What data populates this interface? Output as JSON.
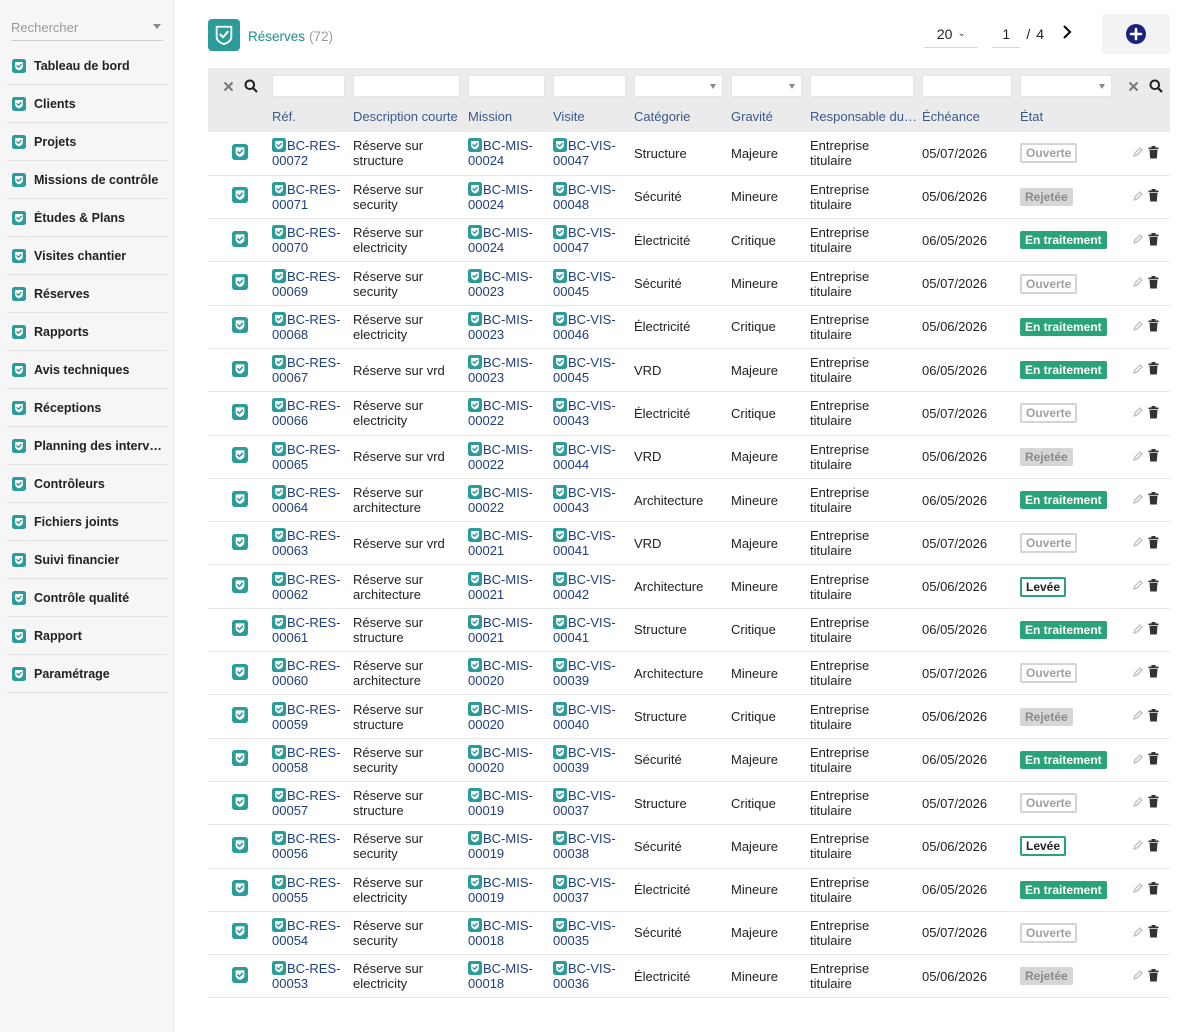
{
  "sidebar": {
    "search_placeholder": "Rechercher",
    "items": [
      {
        "label": "Tableau de bord"
      },
      {
        "label": "Clients"
      },
      {
        "label": "Projets"
      },
      {
        "label": "Missions de contrôle"
      },
      {
        "label": "Études & Plans"
      },
      {
        "label": "Visites chantier"
      },
      {
        "label": "Réserves"
      },
      {
        "label": "Rapports"
      },
      {
        "label": "Avis techniques"
      },
      {
        "label": "Réceptions"
      },
      {
        "label": "Planning des interventions"
      },
      {
        "label": "Contrôleurs"
      },
      {
        "label": "Fichiers joints"
      },
      {
        "label": "Suivi financier"
      },
      {
        "label": "Contrôle qualité"
      },
      {
        "label": "Rapport"
      },
      {
        "label": "Paramétrage"
      }
    ]
  },
  "header": {
    "title": "Réserves",
    "count": "(72)",
    "limit": "20",
    "page": "1",
    "page_sep": "/",
    "total_pages": "4"
  },
  "columns": {
    "ref": "Réf.",
    "desc": "Description courte",
    "mission": "Mission",
    "visite": "Visite",
    "categorie": "Catégorie",
    "gravite": "Gravité",
    "responsable": "Responsable du traitement",
    "echeance": "Échéance",
    "etat": "État"
  },
  "colors": {
    "accent": "#2b9c99",
    "link": "#1f3f7a",
    "status_green": "#2aa27a",
    "add_icon": "#1a237e"
  },
  "icons": {
    "row_checkbox": "shield-check-icon",
    "edit": "pencil-icon",
    "delete": "trash-icon",
    "clear": "close-icon",
    "search": "search-icon",
    "add": "plus-circle-icon",
    "next": "chevron-right-icon"
  },
  "rows": [
    {
      "ref1": "BC-RES-",
      "ref2": "00072",
      "desc1": "Réserve sur",
      "desc2": "structure",
      "mis1": "BC-MIS-",
      "mis2": "00024",
      "vis1": "BC-VIS-",
      "vis2": "00047",
      "cat": "Structure",
      "grav": "Majeure",
      "resp1": "Entreprise",
      "resp2": "titulaire",
      "ech": "05/07/2026",
      "etat": "Ouverte",
      "etat_class": "b-ouverte"
    },
    {
      "ref1": "BC-RES-",
      "ref2": "00071",
      "desc1": "Réserve sur",
      "desc2": "security",
      "mis1": "BC-MIS-",
      "mis2": "00024",
      "vis1": "BC-VIS-",
      "vis2": "00048",
      "cat": "Sécurité",
      "grav": "Mineure",
      "resp1": "Entreprise",
      "resp2": "titulaire",
      "ech": "05/06/2026",
      "etat": "Rejetée",
      "etat_class": "b-rejetee"
    },
    {
      "ref1": "BC-RES-",
      "ref2": "00070",
      "desc1": "Réserve sur",
      "desc2": "electricity",
      "mis1": "BC-MIS-",
      "mis2": "00024",
      "vis1": "BC-VIS-",
      "vis2": "00047",
      "cat": "Électricité",
      "grav": "Critique",
      "resp1": "Entreprise",
      "resp2": "titulaire",
      "ech": "06/05/2026",
      "etat": "En traitement",
      "etat_class": "b-traitement"
    },
    {
      "ref1": "BC-RES-",
      "ref2": "00069",
      "desc1": "Réserve sur",
      "desc2": "security",
      "mis1": "BC-MIS-",
      "mis2": "00023",
      "vis1": "BC-VIS-",
      "vis2": "00045",
      "cat": "Sécurité",
      "grav": "Mineure",
      "resp1": "Entreprise",
      "resp2": "titulaire",
      "ech": "05/07/2026",
      "etat": "Ouverte",
      "etat_class": "b-ouverte"
    },
    {
      "ref1": "BC-RES-",
      "ref2": "00068",
      "desc1": "Réserve sur",
      "desc2": "electricity",
      "mis1": "BC-MIS-",
      "mis2": "00023",
      "vis1": "BC-VIS-",
      "vis2": "00046",
      "cat": "Électricité",
      "grav": "Critique",
      "resp1": "Entreprise",
      "resp2": "titulaire",
      "ech": "05/06/2026",
      "etat": "En traitement",
      "etat_class": "b-traitement"
    },
    {
      "ref1": "BC-RES-",
      "ref2": "00067",
      "desc1": "Réserve sur vrd",
      "desc2": "",
      "mis1": "BC-MIS-",
      "mis2": "00023",
      "vis1": "BC-VIS-",
      "vis2": "00045",
      "cat": "VRD",
      "grav": "Majeure",
      "resp1": "Entreprise",
      "resp2": "titulaire",
      "ech": "06/05/2026",
      "etat": "En traitement",
      "etat_class": "b-traitement"
    },
    {
      "ref1": "BC-RES-",
      "ref2": "00066",
      "desc1": "Réserve sur",
      "desc2": "electricity",
      "mis1": "BC-MIS-",
      "mis2": "00022",
      "vis1": "BC-VIS-",
      "vis2": "00043",
      "cat": "Électricité",
      "grav": "Critique",
      "resp1": "Entreprise",
      "resp2": "titulaire",
      "ech": "05/07/2026",
      "etat": "Ouverte",
      "etat_class": "b-ouverte"
    },
    {
      "ref1": "BC-RES-",
      "ref2": "00065",
      "desc1": "Réserve sur vrd",
      "desc2": "",
      "mis1": "BC-MIS-",
      "mis2": "00022",
      "vis1": "BC-VIS-",
      "vis2": "00044",
      "cat": "VRD",
      "grav": "Majeure",
      "resp1": "Entreprise",
      "resp2": "titulaire",
      "ech": "05/06/2026",
      "etat": "Rejetée",
      "etat_class": "b-rejetee"
    },
    {
      "ref1": "BC-RES-",
      "ref2": "00064",
      "desc1": "Réserve sur",
      "desc2": "architecture",
      "mis1": "BC-MIS-",
      "mis2": "00022",
      "vis1": "BC-VIS-",
      "vis2": "00043",
      "cat": "Architecture",
      "grav": "Mineure",
      "resp1": "Entreprise",
      "resp2": "titulaire",
      "ech": "06/05/2026",
      "etat": "En traitement",
      "etat_class": "b-traitement"
    },
    {
      "ref1": "BC-RES-",
      "ref2": "00063",
      "desc1": "Réserve sur vrd",
      "desc2": "",
      "mis1": "BC-MIS-",
      "mis2": "00021",
      "vis1": "BC-VIS-",
      "vis2": "00041",
      "cat": "VRD",
      "grav": "Majeure",
      "resp1": "Entreprise",
      "resp2": "titulaire",
      "ech": "05/07/2026",
      "etat": "Ouverte",
      "etat_class": "b-ouverte"
    },
    {
      "ref1": "BC-RES-",
      "ref2": "00062",
      "desc1": "Réserve sur",
      "desc2": "architecture",
      "mis1": "BC-MIS-",
      "mis2": "00021",
      "vis1": "BC-VIS-",
      "vis2": "00042",
      "cat": "Architecture",
      "grav": "Mineure",
      "resp1": "Entreprise",
      "resp2": "titulaire",
      "ech": "05/06/2026",
      "etat": "Levée",
      "etat_class": "b-levee"
    },
    {
      "ref1": "BC-RES-",
      "ref2": "00061",
      "desc1": "Réserve sur",
      "desc2": "structure",
      "mis1": "BC-MIS-",
      "mis2": "00021",
      "vis1": "BC-VIS-",
      "vis2": "00041",
      "cat": "Structure",
      "grav": "Critique",
      "resp1": "Entreprise",
      "resp2": "titulaire",
      "ech": "06/05/2026",
      "etat": "En traitement",
      "etat_class": "b-traitement"
    },
    {
      "ref1": "BC-RES-",
      "ref2": "00060",
      "desc1": "Réserve sur",
      "desc2": "architecture",
      "mis1": "BC-MIS-",
      "mis2": "00020",
      "vis1": "BC-VIS-",
      "vis2": "00039",
      "cat": "Architecture",
      "grav": "Mineure",
      "resp1": "Entreprise",
      "resp2": "titulaire",
      "ech": "05/07/2026",
      "etat": "Ouverte",
      "etat_class": "b-ouverte"
    },
    {
      "ref1": "BC-RES-",
      "ref2": "00059",
      "desc1": "Réserve sur",
      "desc2": "structure",
      "mis1": "BC-MIS-",
      "mis2": "00020",
      "vis1": "BC-VIS-",
      "vis2": "00040",
      "cat": "Structure",
      "grav": "Critique",
      "resp1": "Entreprise",
      "resp2": "titulaire",
      "ech": "05/06/2026",
      "etat": "Rejetée",
      "etat_class": "b-rejetee"
    },
    {
      "ref1": "BC-RES-",
      "ref2": "00058",
      "desc1": "Réserve sur",
      "desc2": "security",
      "mis1": "BC-MIS-",
      "mis2": "00020",
      "vis1": "BC-VIS-",
      "vis2": "00039",
      "cat": "Sécurité",
      "grav": "Majeure",
      "resp1": "Entreprise",
      "resp2": "titulaire",
      "ech": "06/05/2026",
      "etat": "En traitement",
      "etat_class": "b-traitement"
    },
    {
      "ref1": "BC-RES-",
      "ref2": "00057",
      "desc1": "Réserve sur",
      "desc2": "structure",
      "mis1": "BC-MIS-",
      "mis2": "00019",
      "vis1": "BC-VIS-",
      "vis2": "00037",
      "cat": "Structure",
      "grav": "Critique",
      "resp1": "Entreprise",
      "resp2": "titulaire",
      "ech": "05/07/2026",
      "etat": "Ouverte",
      "etat_class": "b-ouverte"
    },
    {
      "ref1": "BC-RES-",
      "ref2": "00056",
      "desc1": "Réserve sur",
      "desc2": "security",
      "mis1": "BC-MIS-",
      "mis2": "00019",
      "vis1": "BC-VIS-",
      "vis2": "00038",
      "cat": "Sécurité",
      "grav": "Majeure",
      "resp1": "Entreprise",
      "resp2": "titulaire",
      "ech": "05/06/2026",
      "etat": "Levée",
      "etat_class": "b-levee"
    },
    {
      "ref1": "BC-RES-",
      "ref2": "00055",
      "desc1": "Réserve sur",
      "desc2": "electricity",
      "mis1": "BC-MIS-",
      "mis2": "00019",
      "vis1": "BC-VIS-",
      "vis2": "00037",
      "cat": "Électricité",
      "grav": "Mineure",
      "resp1": "Entreprise",
      "resp2": "titulaire",
      "ech": "06/05/2026",
      "etat": "En traitement",
      "etat_class": "b-traitement"
    },
    {
      "ref1": "BC-RES-",
      "ref2": "00054",
      "desc1": "Réserve sur",
      "desc2": "security",
      "mis1": "BC-MIS-",
      "mis2": "00018",
      "vis1": "BC-VIS-",
      "vis2": "00035",
      "cat": "Sécurité",
      "grav": "Majeure",
      "resp1": "Entreprise",
      "resp2": "titulaire",
      "ech": "05/07/2026",
      "etat": "Ouverte",
      "etat_class": "b-ouverte"
    },
    {
      "ref1": "BC-RES-",
      "ref2": "00053",
      "desc1": "Réserve sur",
      "desc2": "electricity",
      "mis1": "BC-MIS-",
      "mis2": "00018",
      "vis1": "BC-VIS-",
      "vis2": "00036",
      "cat": "Électricité",
      "grav": "Mineure",
      "resp1": "Entreprise",
      "resp2": "titulaire",
      "ech": "05/06/2026",
      "etat": "Rejetée",
      "etat_class": "b-rejetee"
    }
  ]
}
